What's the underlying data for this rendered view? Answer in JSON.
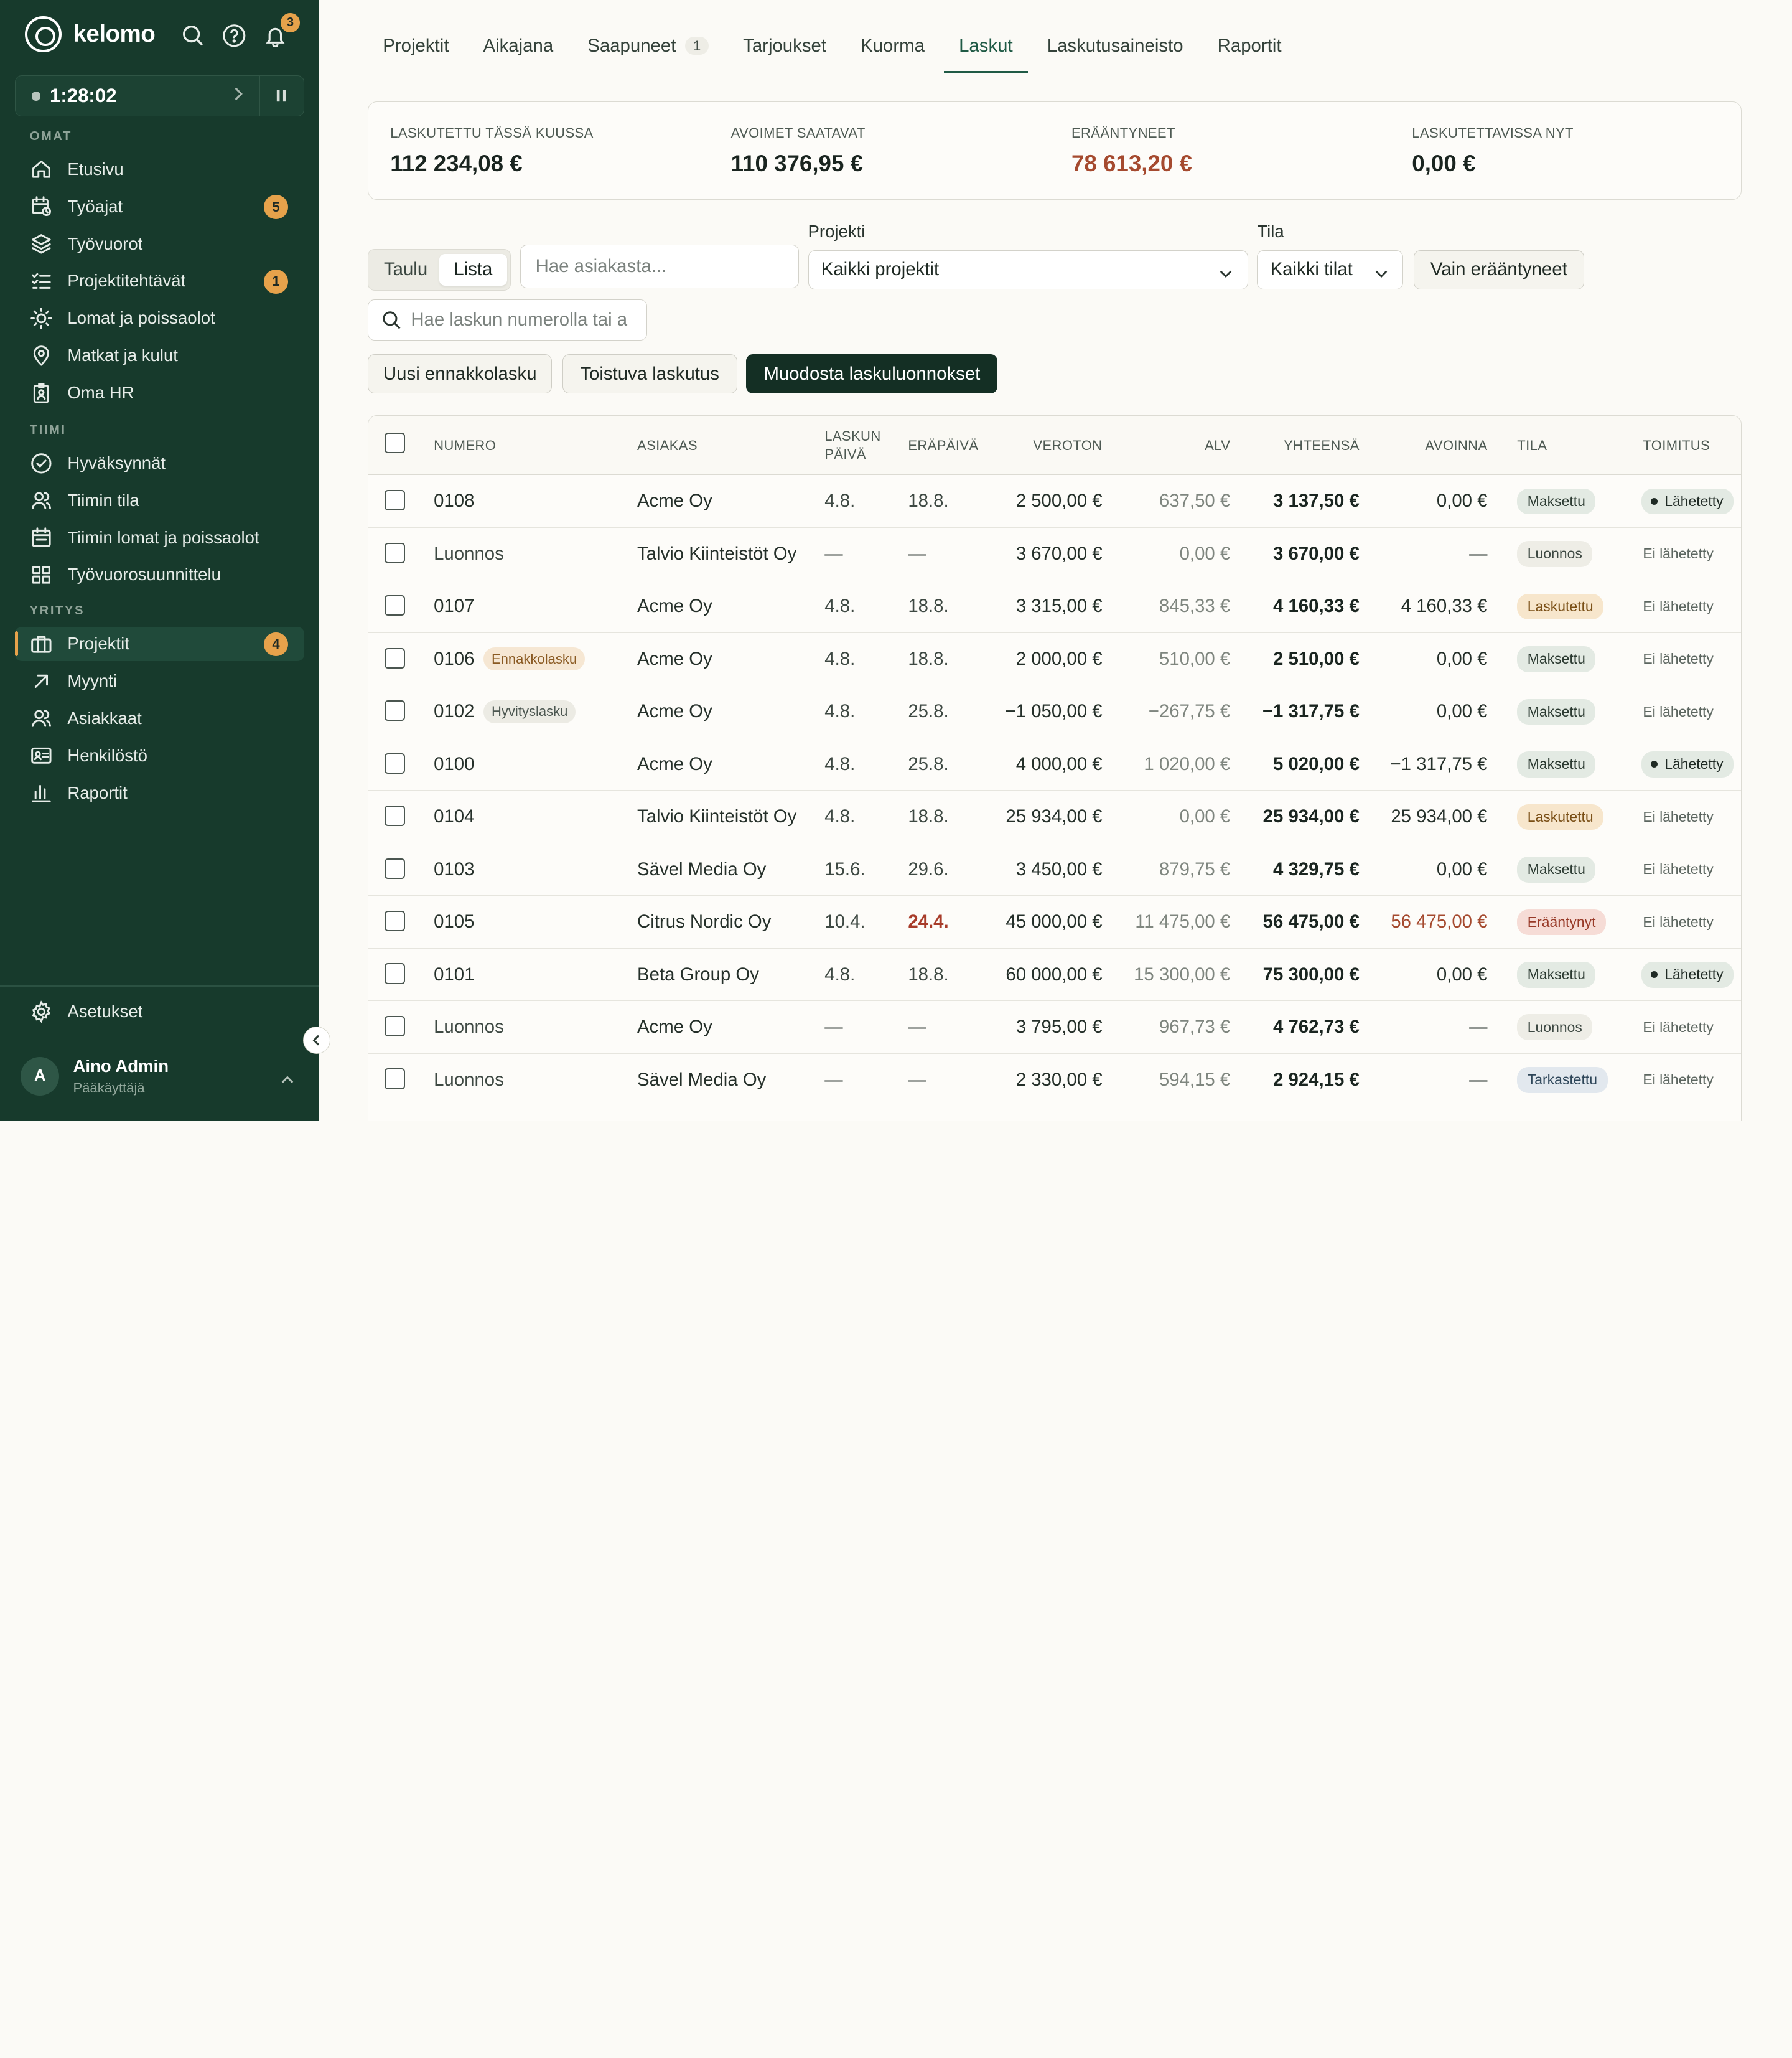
{
  "app": {
    "brand": "kelomo",
    "notifications": "3"
  },
  "timer": {
    "time": "1:28:02"
  },
  "sidebar": {
    "sections": {
      "own": "OMAT",
      "team": "TIIMI",
      "company": "YRITYS"
    },
    "own": [
      {
        "label": "Etusivu",
        "icon": "home-icon"
      },
      {
        "label": "Työajat",
        "icon": "calendar-clock-icon",
        "badge": "5"
      },
      {
        "label": "Työvuorot",
        "icon": "layers-icon"
      },
      {
        "label": "Projektitehtävät",
        "icon": "checklist-icon",
        "badge": "1"
      },
      {
        "label": "Lomat ja poissaolot",
        "icon": "sun-icon"
      },
      {
        "label": "Matkat ja kulut",
        "icon": "map-pin-icon"
      },
      {
        "label": "Oma HR",
        "icon": "badge-icon"
      }
    ],
    "team": [
      {
        "label": "Hyväksynnät",
        "icon": "check-circle-icon"
      },
      {
        "label": "Tiimin tila",
        "icon": "users-icon"
      },
      {
        "label": "Tiimin lomat ja poissaolot",
        "icon": "calendar-icon"
      },
      {
        "label": "Työvuorosuunnittelu",
        "icon": "grid-icon"
      }
    ],
    "company": [
      {
        "label": "Projektit",
        "icon": "briefcase-icon",
        "badge": "4",
        "active": true
      },
      {
        "label": "Myynti",
        "icon": "arrow-up-right-icon"
      },
      {
        "label": "Asiakkaat",
        "icon": "users-icon"
      },
      {
        "label": "Henkilöstö",
        "icon": "id-card-icon"
      },
      {
        "label": "Raportit",
        "icon": "bar-chart-icon"
      }
    ],
    "settings": "Asetukset",
    "user": {
      "initial": "A",
      "name": "Aino Admin",
      "role": "Pääkäyttäjä"
    }
  },
  "tabs": [
    {
      "label": "Projektit"
    },
    {
      "label": "Aikajana"
    },
    {
      "label": "Saapuneet",
      "count": "1"
    },
    {
      "label": "Tarjoukset"
    },
    {
      "label": "Kuorma"
    },
    {
      "label": "Laskut",
      "active": true
    },
    {
      "label": "Laskutusaineisto"
    },
    {
      "label": "Raportit"
    }
  ],
  "stats": [
    {
      "label": "LASKUTETTU TÄSSÄ KUUSSA",
      "value": "112 234,08 €"
    },
    {
      "label": "AVOIMET SAATAVAT",
      "value": "110 376,95 €"
    },
    {
      "label": "ERÄÄNTYNEET",
      "value": "78 613,20 €",
      "alert": true
    },
    {
      "label": "LASKUTETTAVISSA NYT",
      "value": "0,00 €"
    }
  ],
  "filters": {
    "view_table": "Taulu",
    "view_list": "Lista",
    "customer_placeholder": "Hae asiakasta...",
    "project_label": "Projekti",
    "project_value": "Kaikki projektit",
    "status_label": "Tila",
    "status_value": "Kaikki tilat",
    "overdue_only": "Vain erääntyneet",
    "invoice_search_placeholder": "Hae laskun numerolla tai a"
  },
  "actions": {
    "new_advance": "Uusi ennakkolasku",
    "recurring": "Toistuva laskutus",
    "generate_drafts": "Muodosta laskuluonnokset"
  },
  "table": {
    "headers": {
      "number": "NUMERO",
      "customer": "ASIAKAS",
      "invoice_date_1": "LASKUN",
      "invoice_date_2": "PÄIVÄ",
      "due": "ERÄPÄIVÄ",
      "net": "VEROTON",
      "vat": "ALV",
      "total": "YHTEENSÄ",
      "open": "AVOINNA",
      "status": "TILA",
      "delivery": "TOIMITUS"
    },
    "rows": [
      {
        "number": "0108",
        "customer": "Acme Oy",
        "date": "4.8.",
        "due": "18.8.",
        "net": "2 500,00 €",
        "vat": "637,50 €",
        "total": "3 137,50 €",
        "open": "0,00 €",
        "status": "Maksettu",
        "status_kind": "maksettu",
        "delivery": "Lähetetty",
        "sent": true
      },
      {
        "number": "Luonnos",
        "draft": true,
        "customer": "Talvio Kiinteistöt Oy",
        "date": "—",
        "due": "—",
        "net": "3 670,00 €",
        "vat": "0,00 €",
        "total": "3 670,00 €",
        "open": "—",
        "status": "Luonnos",
        "status_kind": "luonnos",
        "delivery": "Ei lähetetty"
      },
      {
        "number": "0107",
        "customer": "Acme Oy",
        "date": "4.8.",
        "due": "18.8.",
        "net": "3 315,00 €",
        "vat": "845,33 €",
        "total": "4 160,33 €",
        "open": "4 160,33 €",
        "status": "Laskutettu",
        "status_kind": "laskutettu",
        "delivery": "Ei lähetetty"
      },
      {
        "number": "0106",
        "tag": "Ennakkolasku",
        "tag_kind": "ennakko",
        "customer": "Acme Oy",
        "date": "4.8.",
        "due": "18.8.",
        "net": "2 000,00 €",
        "vat": "510,00 €",
        "total": "2 510,00 €",
        "open": "0,00 €",
        "status": "Maksettu",
        "status_kind": "maksettu",
        "delivery": "Ei lähetetty"
      },
      {
        "number": "0102",
        "tag": "Hyvityslasku",
        "tag_kind": "hyvitys",
        "customer": "Acme Oy",
        "date": "4.8.",
        "due": "25.8.",
        "net": "−1 050,00 €",
        "vat": "−267,75 €",
        "total": "−1 317,75 €",
        "open": "0,00 €",
        "status": "Maksettu",
        "status_kind": "maksettu",
        "delivery": "Ei lähetetty"
      },
      {
        "number": "0100",
        "customer": "Acme Oy",
        "date": "4.8.",
        "due": "25.8.",
        "net": "4 000,00 €",
        "vat": "1 020,00 €",
        "total": "5 020,00 €",
        "open": "−1 317,75 €",
        "status": "Maksettu",
        "status_kind": "maksettu",
        "delivery": "Lähetetty",
        "sent": true
      },
      {
        "number": "0104",
        "customer": "Talvio Kiinteistöt Oy",
        "date": "4.8.",
        "due": "18.8.",
        "net": "25 934,00 €",
        "vat": "0,00 €",
        "total": "25 934,00 €",
        "open": "25 934,00 €",
        "status": "Laskutettu",
        "status_kind": "laskutettu",
        "delivery": "Ei lähetetty"
      },
      {
        "number": "0103",
        "customer": "Sävel Media Oy",
        "date": "15.6.",
        "due": "29.6.",
        "net": "3 450,00 €",
        "vat": "879,75 €",
        "total": "4 329,75 €",
        "open": "0,00 €",
        "status": "Maksettu",
        "status_kind": "maksettu",
        "delivery": "Ei lähetetty"
      },
      {
        "number": "0105",
        "customer": "Citrus Nordic Oy",
        "date": "10.4.",
        "due": "24.4.",
        "overdue": true,
        "net": "45 000,00 €",
        "vat": "11 475,00 €",
        "total": "56 475,00 €",
        "open": "56 475,00 €",
        "status": "Erääntynyt",
        "status_kind": "eraantynyt",
        "delivery": "Ei lähetetty"
      },
      {
        "number": "0101",
        "customer": "Beta Group Oy",
        "date": "4.8.",
        "due": "18.8.",
        "net": "60 000,00 €",
        "vat": "15 300,00 €",
        "total": "75 300,00 €",
        "open": "0,00 €",
        "status": "Maksettu",
        "status_kind": "maksettu",
        "delivery": "Lähetetty",
        "sent": true
      },
      {
        "number": "Luonnos",
        "draft": true,
        "customer": "Acme Oy",
        "date": "—",
        "due": "—",
        "net": "3 795,00 €",
        "vat": "967,73 €",
        "total": "4 762,73 €",
        "open": "—",
        "status": "Luonnos",
        "status_kind": "luonnos",
        "delivery": "Ei lähetetty"
      },
      {
        "number": "Luonnos",
        "draft": true,
        "customer": "Sävel Media Oy",
        "date": "—",
        "due": "—",
        "net": "2 330,00 €",
        "vat": "594,15 €",
        "total": "2 924,15 €",
        "open": "—",
        "status": "Tarkastettu",
        "status_kind": "tarkastettu",
        "delivery": "Ei lähetetty"
      }
    ]
  }
}
